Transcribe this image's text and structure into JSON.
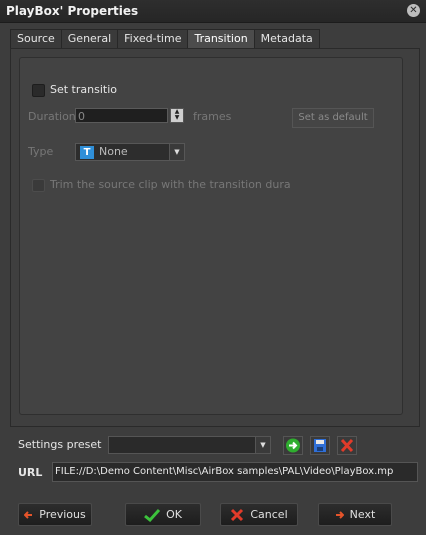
{
  "window": {
    "title": "PlayBox' Properties"
  },
  "tabs": [
    {
      "label": "Source"
    },
    {
      "label": "General"
    },
    {
      "label": "Fixed-time"
    },
    {
      "label": "Transition",
      "active": true
    },
    {
      "label": "Metadata"
    }
  ],
  "transition": {
    "set_transition_label": "Set transitio",
    "duration_label": "Duration",
    "duration_value": "0",
    "frames_label": "frames",
    "set_default_label": "Set as default",
    "type_label": "Type",
    "type_value": "None",
    "trim_label": "Trim the source clip with the transition dura"
  },
  "footer": {
    "settings_preset_label": "Settings preset",
    "url_label": "URL",
    "url_value": "FILE://D:\\Demo Content\\Misc\\AirBox samples\\PAL\\Video\\PlayBox.mp"
  },
  "buttons": {
    "previous": "Previous",
    "ok": "OK",
    "cancel": "Cancel",
    "next": "Next"
  },
  "colors": {
    "accent_blue": "#2f8fd8",
    "apply_green": "#2fae2f",
    "delete_red": "#e23b2a",
    "nav_orange": "#e5542a"
  }
}
